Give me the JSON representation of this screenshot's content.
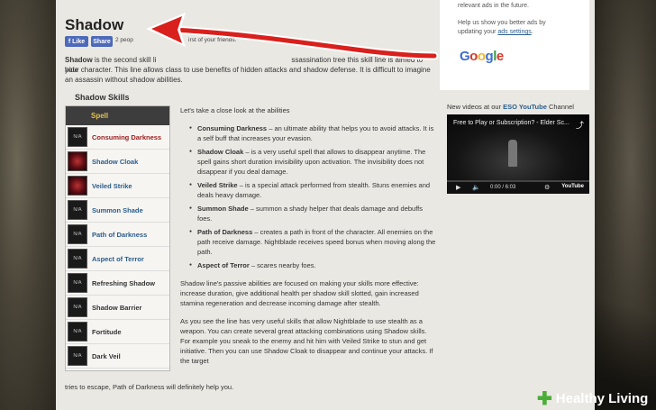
{
  "page": {
    "title": "Shadow",
    "like_label": "Like",
    "share_label": "Share",
    "like_count_left": "2 peop",
    "like_count_right": "irst of your friends.",
    "intro_bold": "Shadow",
    "intro_rest_a": " is the second skill li",
    "intro_rest_b": "ssassination tree this skill line is aimed to hide",
    "intro_line2": "your character. This line allows  class to use benefits of hidden attacks and shadow defense. It is difficult to imagine an assassin without shadow abilities.",
    "skills_heading": "Shadow Skills",
    "skills_header": "Spell",
    "skills": [
      {
        "label": "Consuming Darkness",
        "icon": "N/A",
        "color": "red"
      },
      {
        "label": "Shadow Cloak",
        "icon": "art",
        "color": "blue"
      },
      {
        "label": "Veiled Strike",
        "icon": "art",
        "color": "blue"
      },
      {
        "label": "Summon Shade",
        "icon": "N/A",
        "color": "blue"
      },
      {
        "label": "Path of Darkness",
        "icon": "N/A",
        "color": "blue"
      },
      {
        "label": "Aspect of Terror",
        "icon": "N/A",
        "color": "blue"
      },
      {
        "label": "Refreshing Shadow",
        "icon": "N/A",
        "color": "dark"
      },
      {
        "label": "Shadow Barrier",
        "icon": "N/A",
        "color": "dark"
      },
      {
        "label": "Fortitude",
        "icon": "N/A",
        "color": "dark"
      },
      {
        "label": "Dark Veil",
        "icon": "N/A",
        "color": "dark"
      }
    ],
    "content_intro": "Let's take a close look at the abilities",
    "abilities": [
      {
        "name": "Consuming Darkness",
        "desc": " – an ultimate ability that helps you to avoid attacks. It is a self buff that increases your evasion."
      },
      {
        "name": "Shadow Cloak",
        "desc": " – is a very useful spell that allows to disappear anytime. The spell gains short duration invisibility upon activation. The invisibility does not disappear if you deal damage."
      },
      {
        "name": "Veiled Strike",
        "desc": " – is a special attack performed from stealth. Stuns enemies and deals heavy damage."
      },
      {
        "name": "Summon Shade",
        "desc": " – summon a shady helper that deals damage and debuffs foes."
      },
      {
        "name": "Path of Darkness",
        "desc": " – creates a path in front of the character. All enemies on the path receive damage. Nightblade receives speed bonus when moving along the path."
      },
      {
        "name": "Aspect of Terror",
        "desc": " – scares nearby foes."
      }
    ],
    "passive_text": "Shadow line's passive abilities are focused on making your skills more effective: increase duration, give additional health per shadow skill slotted, gain increased stamina regeneration and decrease incoming damage after stealth.",
    "tips_text": "As you see the line has very useful skills that allow Nightblade to use stealth as a weapon. You can create several great attacking combinations using Shadow skills. For example you sneak to the enemy and hit him with Veiled Strike to stun and get initiative. Then you can use Shadow Cloak to disappear and continue your attacks. If the target",
    "last_line": "tries to escape, Path of Darkness will definitely help you."
  },
  "sidebar": {
    "ad_line1": "relevant ads in the future.",
    "ad_line2": "Help us show you better ads by",
    "ad_line3_prefix": "updating your ",
    "ad_line3_link": "ads settings",
    "ad_line3_suffix": ".",
    "google_letters": [
      "G",
      "o",
      "o",
      "g",
      "l",
      "e"
    ],
    "video_label_prefix": "New videos at our ",
    "video_label_link": "ESO YouTube",
    "video_label_suffix": " Channel",
    "video_title": "Free to Play or Subscription? - Elder Sc...",
    "video_time": "0:00 / 6:03",
    "video_progress": 0
  },
  "brand": {
    "name": "Healthy Living",
    "accent_color": "#4cae3a"
  },
  "colors": {
    "arrow": "#d9201c",
    "link": "#2a5d8c",
    "skill_red": "#9a1a1a",
    "header_gold": "#e5c24a"
  }
}
